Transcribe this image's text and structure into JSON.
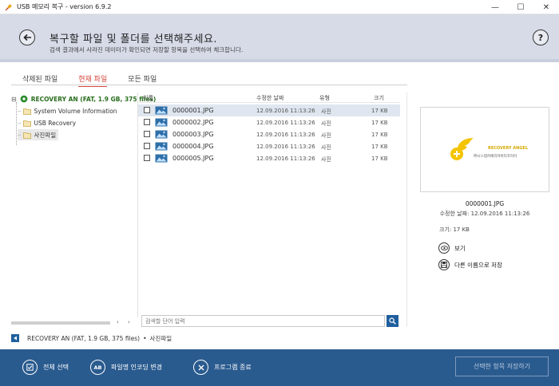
{
  "window": {
    "title": "USB 메모리 복구 - version 6.9.2",
    "controls": {
      "minimize": "—",
      "maximize": "☐",
      "close": "✕"
    }
  },
  "header": {
    "title": "복구할 파일 및 폴더를 선택해주세요.",
    "subtitle": "검색 결과에서 사라진 데이터가 확인되면 저장할 항목을 선택하여 체크합니다.",
    "help": "?"
  },
  "tabs": [
    {
      "label": "삭제된 파일",
      "active": false
    },
    {
      "label": "현재 파일",
      "active": true
    },
    {
      "label": "모든 파일",
      "active": false
    }
  ],
  "tree": {
    "toggle": "⊟",
    "root": "RECOVERY AN (FAT, 1.9 GB, 375 files)",
    "children": [
      "System Volume Information",
      "USB Recovery",
      "사진파일"
    ],
    "scroll_left": "‹",
    "scroll_right": "›"
  },
  "list": {
    "columns": {
      "name": "이름",
      "date": "수정한 날짜",
      "type": "유형",
      "size": "크기"
    },
    "rows": [
      {
        "name": "0000001.JPG",
        "date": "12.09.2016 11:13:26",
        "type": "사진",
        "size": "17 KB"
      },
      {
        "name": "0000002.JPG",
        "date": "12.09.2016 11:13:26",
        "type": "사진",
        "size": "17 KB"
      },
      {
        "name": "0000003.JPG",
        "date": "12.09.2016 11:13:26",
        "type": "사진",
        "size": "17 KB"
      },
      {
        "name": "0000004.JPG",
        "date": "12.09.2016 11:13:26",
        "type": "사진",
        "size": "17 KB"
      },
      {
        "name": "0000005.JPG",
        "date": "12.09.2016 11:13:26",
        "type": "사진",
        "size": "17 KB"
      }
    ]
  },
  "search": {
    "placeholder": "검색할 단어 입력"
  },
  "preview": {
    "logo_text": "RECOVERY ANGEL",
    "logo_subtext": "㈜시스템카페리커버리코리아",
    "file_name": "0000001.JPG",
    "modified": "수정한 날짜: 12.09.2016 11:13:26",
    "size": "크기: 17 KB",
    "view_label": "보기",
    "save_as_label": "다른 이름으로 저장"
  },
  "pathbar": {
    "drive": "RECOVERY AN (FAT, 1.9 GB, 375 files)",
    "separator": "•",
    "folder": "사진파일"
  },
  "footer": {
    "select_all": "전체 선택",
    "ab_glyph": "AB",
    "encoding": "파일명 인코딩 변경",
    "exit": "프로그램 종료",
    "save_selected": "선택한 항목 저장하기"
  },
  "colors": {
    "header_bg": "#d7dbe8",
    "footer_bg": "#2a5b8f",
    "tab_active": "#d6453c",
    "selection": "#dfe6ef",
    "tree_root": "#2a6e1f"
  }
}
